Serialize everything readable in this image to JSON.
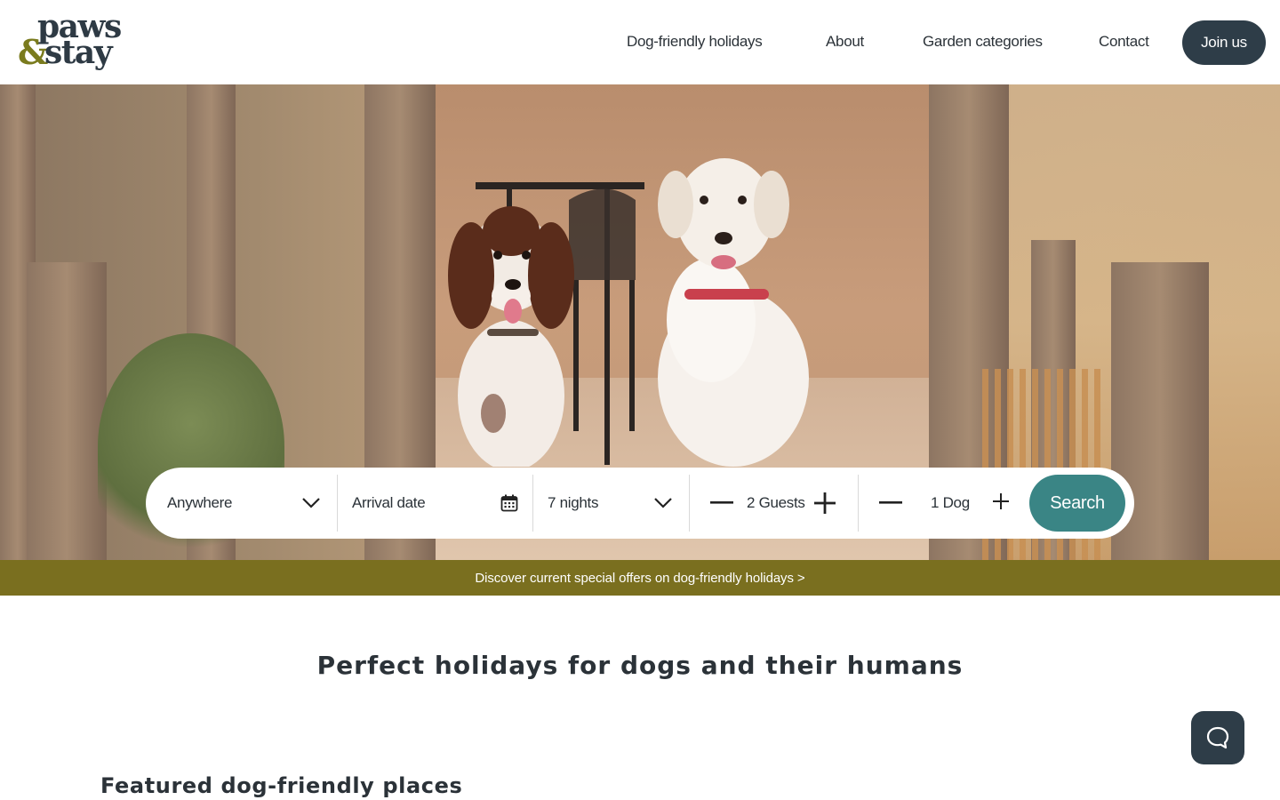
{
  "brand": {
    "logo_line1": "paws",
    "logo_amp": "&",
    "logo_line2": "stay"
  },
  "nav": {
    "items": [
      {
        "label": "Dog-friendly holidays"
      },
      {
        "label": "About"
      },
      {
        "label": "Garden categories"
      },
      {
        "label": "Contact"
      }
    ],
    "join_label": "Join us"
  },
  "search": {
    "location": "Anywhere",
    "arrival": "Arrival date",
    "nights": "7 nights",
    "guests": "2 Guests",
    "dogs": "1 Dog",
    "button_label": "Search"
  },
  "offer": {
    "text": "Discover current special offers on dog-friendly holidays >"
  },
  "main": {
    "title": "Perfect holidays for dogs and their humans",
    "featured_title": "Featured dog-friendly places"
  },
  "colors": {
    "brand_dark": "#2e3d48",
    "brand_olive": "#7a6f1f",
    "search_teal": "#3a8585"
  }
}
